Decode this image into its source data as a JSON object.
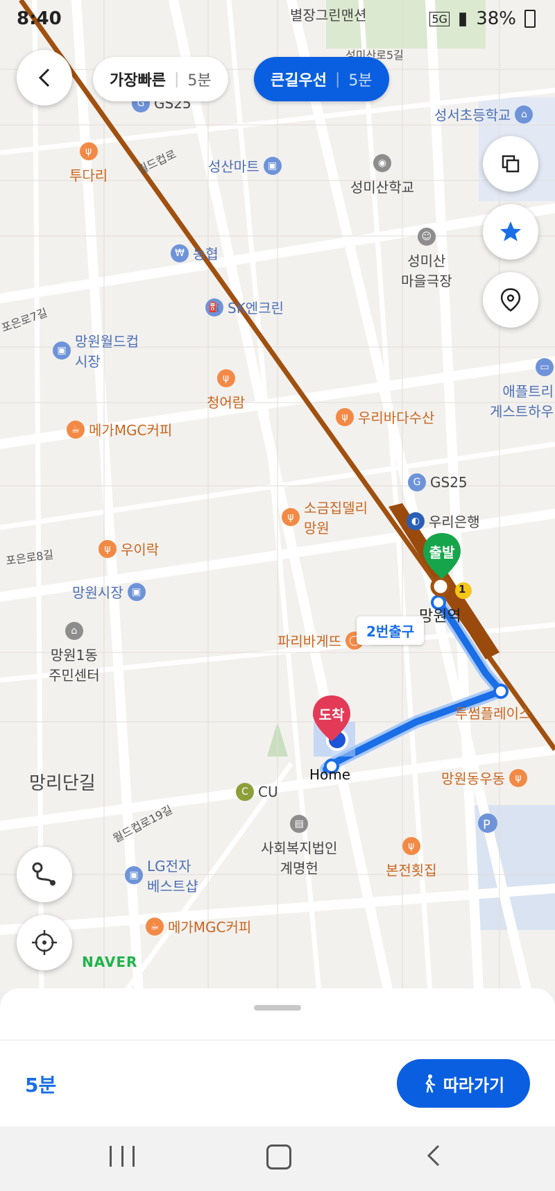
{
  "status": {
    "time": "8:40",
    "battery": "38%",
    "network": "5G"
  },
  "route_tabs": [
    {
      "label": "가장빠른",
      "time": "5분"
    },
    {
      "label": "큰길우선",
      "time": "5분"
    }
  ],
  "map": {
    "pois": [
      {
        "name": "성산마트"
      },
      {
        "name": "성미산학교"
      },
      {
        "name": "투다리"
      },
      {
        "name": "농협"
      },
      {
        "name": "SK엔크린"
      },
      {
        "name": "성미산\n마을극장"
      },
      {
        "name": "망원월드컵\n시장"
      },
      {
        "name": "청어람"
      },
      {
        "name": "우리바다수산"
      },
      {
        "name": "메가MGC커피"
      },
      {
        "name": "GS25"
      },
      {
        "name": "소금집델리\n망원"
      },
      {
        "name": "우리은행"
      },
      {
        "name": "우이락"
      },
      {
        "name": "망원시장"
      },
      {
        "name": "파리바게뜨"
      },
      {
        "name": "망원1동\n주민센터"
      },
      {
        "name": "투썸플레이스"
      },
      {
        "name": "망원동우동"
      },
      {
        "name": "CU"
      },
      {
        "name": "사회복지법인\n계명헌"
      },
      {
        "name": "LG전자\n베스트샵"
      },
      {
        "name": "본전횟집"
      },
      {
        "name": "메가MGC커피"
      },
      {
        "name": "성서초등학교"
      },
      {
        "name": "애플트리\n게스트하우"
      },
      {
        "name": "별장그린맨션"
      },
      {
        "name": "망리단길"
      },
      {
        "name": "GS25"
      }
    ],
    "streets": [
      "월드컵로",
      "성미산로5길",
      "포은로8길",
      "월드컵로19길",
      "포은로7길"
    ],
    "start_marker": "출발",
    "end_marker": "도착",
    "exit_label": "2번출구",
    "home_label": "Home",
    "station_label": "망원역",
    "exit_number": "1",
    "logo": "NAVER",
    "route_color": "#1a6ee6",
    "subway_color": "#a0500f"
  },
  "bottom": {
    "duration": "5분",
    "follow_button": "따라가기"
  },
  "colors": {
    "primary": "#0a5fe0",
    "start": "#17a54c",
    "end": "#e33a57"
  }
}
